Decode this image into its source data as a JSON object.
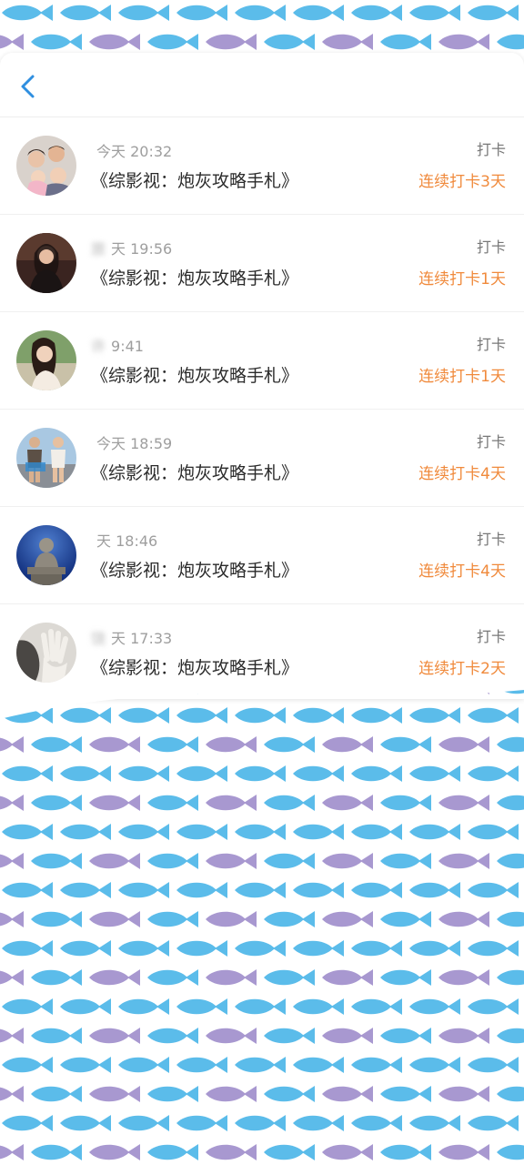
{
  "header": {
    "back_icon": "chevron-left-icon"
  },
  "feed": [
    {
      "name": "",
      "time": "今天 20:32",
      "book": "《综影视：炮灰攻略手札》",
      "action": "打卡",
      "streak": "连续打卡3天",
      "avatar_icon": "family-photo-avatar"
    },
    {
      "name": "旅",
      "time": "天 19:56",
      "book": "《综影视：炮灰攻略手札》",
      "action": "打卡",
      "streak": "连续打卡1天",
      "avatar_icon": "woman-dark-avatar"
    },
    {
      "name": "许",
      "time": "9:41",
      "book": "《综影视：炮灰攻略手札》",
      "action": "打卡",
      "streak": "连续打卡1天",
      "avatar_icon": "woman-portrait-avatar"
    },
    {
      "name": "",
      "time": "今天 18:59",
      "book": "《综影视：炮灰攻略手札》",
      "action": "打卡",
      "streak": "连续打卡4天",
      "avatar_icon": "two-people-avatar"
    },
    {
      "name": "",
      "time": "天 18:46",
      "book": "《综影视：炮灰攻略手札》",
      "action": "打卡",
      "streak": "连续打卡4天",
      "avatar_icon": "buddha-statue-avatar"
    },
    {
      "name": "饶",
      "time": "天 17:33",
      "book": "《综影视：炮灰攻略手札》",
      "action": "打卡",
      "streak": "连续打卡2天",
      "avatar_icon": "hand-portrait-avatar"
    }
  ],
  "colors": {
    "streak": "#f08a3c",
    "back_icon": "#2f8fe0",
    "fish_blue": "#5bbcea",
    "fish_purple": "#a898d0"
  }
}
